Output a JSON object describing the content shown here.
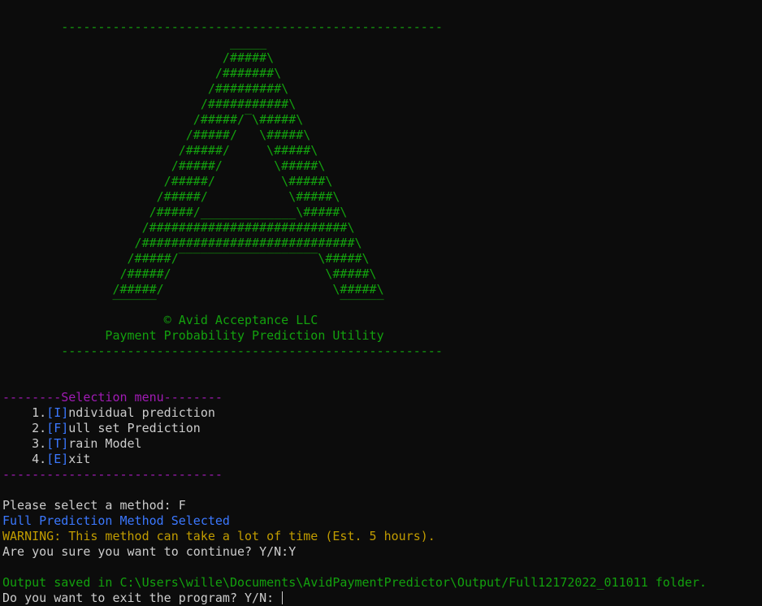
{
  "banner": {
    "rule_top": "        ----------------------------------------------------",
    "art": [
      "                               _____",
      "                              /#####\\",
      "                             /#######\\",
      "                            /#########\\",
      "                           /###########\\",
      "                          /#####/‾\\#####\\",
      "                         /#####/   \\#####\\",
      "                        /#####/     \\#####\\",
      "                       /#####/       \\#####\\",
      "                      /#####/         \\#####\\",
      "                     /#####/           \\#####\\",
      "                    /#####/_____________\\#####\\",
      "                   /###########################\\",
      "                  /#############################\\",
      "                 /#####/‾‾‾‾‾‾‾‾‾‾‾‾‾‾‾‾‾‾‾\\#####\\",
      "                /#####/                     \\#####\\",
      "               /#####/                       \\#####\\",
      "               ‾‾‾‾‾‾                         ‾‾‾‾‾‾"
    ],
    "copyright": "                      © Avid Acceptance LLC",
    "subtitle": "              Payment Probability Prediction Utility",
    "rule_bottom": "        ----------------------------------------------------"
  },
  "menu": {
    "header": "--------Selection menu--------",
    "items": [
      {
        "num": "    1.",
        "key": "[I]",
        "rest": "ndividual prediction"
      },
      {
        "num": "    2.",
        "key": "[F]",
        "rest": "ull set Prediction"
      },
      {
        "num": "    3.",
        "key": "[T]",
        "rest": "rain Model"
      },
      {
        "num": "    4.",
        "key": "[E]",
        "rest": "xit"
      }
    ],
    "footer": "------------------------------"
  },
  "session": {
    "prompt_method": "Please select a method: F",
    "selected": "Full Prediction Method Selected",
    "warning": "WARNING: This method can take a lot of time (Est. 5 hours).",
    "confirm": "Are you sure you want to continue? Y/N:Y",
    "output": "Output saved in C:\\Users\\wille\\Documents\\AvidPaymentPredictor\\Output/Full12172022_011011 folder.",
    "exit_prompt": "Do you want to exit the program? Y/N: "
  },
  "colors": {
    "background": "#0c0c0c",
    "green": "#13a10e",
    "magenta": "#a01bb4",
    "blue": "#3b78ff",
    "yellow": "#c19c00",
    "text": "#cccccc"
  }
}
